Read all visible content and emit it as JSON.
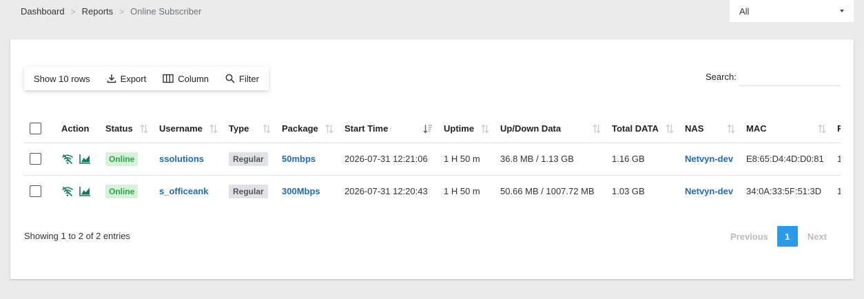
{
  "breadcrumb": {
    "items": [
      "Dashboard",
      "Reports",
      "Online Subscriber"
    ],
    "separator": ">"
  },
  "top_select": {
    "value": "All"
  },
  "toolbar": {
    "show_rows": "Show 10 rows",
    "export": "Export",
    "column": "Column",
    "filter": "Filter"
  },
  "search": {
    "label": "Search:",
    "value": ""
  },
  "table": {
    "headers": [
      "Action",
      "Status",
      "Username",
      "Type",
      "Package",
      "Start Time",
      "Uptime",
      "Up/Down Data",
      "Total DATA",
      "NAS",
      "MAC",
      "F"
    ],
    "rows": [
      {
        "status": "Online",
        "username": "ssolutions",
        "type": "Regular",
        "package": "50mbps",
        "start_time": "2026-07-31 12:21:06",
        "uptime": "1 H 50 m",
        "updown": "36.8 MB / 1.13 GB",
        "total": "1.16 GB",
        "nas": "Netvyn-dev",
        "mac": "E8:65:D4:4D:D0:81",
        "extra": "1"
      },
      {
        "status": "Online",
        "username": "s_officeank",
        "type": "Regular",
        "package": "300Mbps",
        "start_time": "2026-07-31 12:20:43",
        "uptime": "1 H 50 m",
        "updown": "50.66 MB / 1007.72 MB",
        "total": "1.03 GB",
        "nas": "Netvyn-dev",
        "mac": "34:0A:33:5F:51:3D",
        "extra": "1"
      }
    ]
  },
  "footer": {
    "info": "Showing 1 to 2 of 2 entries",
    "pagination": {
      "previous": "Previous",
      "current": "1",
      "next": "Next"
    }
  },
  "colors": {
    "link": "#1e6bb8",
    "online_text": "#28a745",
    "online_bg": "#d4f3da",
    "action_teal": "#117a65",
    "page_active": "#2d9ae8"
  },
  "icons": [
    "download-icon",
    "columns-icon",
    "search-icon",
    "sort-icon",
    "sort-desc-icon",
    "wifi-off-icon",
    "chart-area-icon",
    "caret-down-icon"
  ]
}
